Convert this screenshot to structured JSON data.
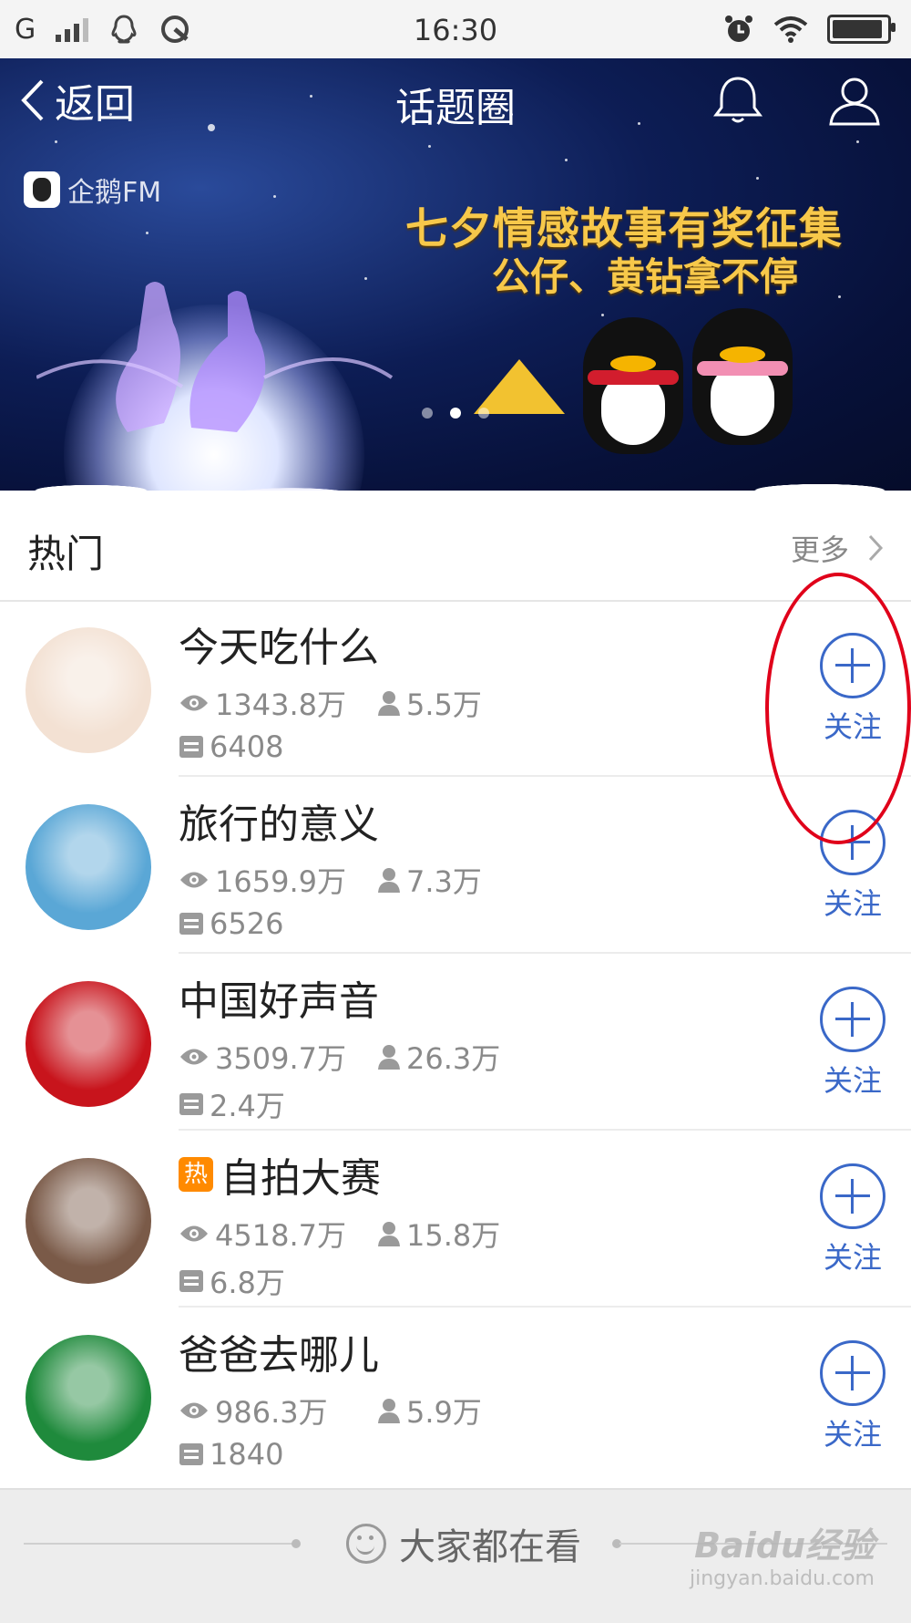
{
  "status_bar": {
    "carrier": "G",
    "time": "16:30"
  },
  "nav": {
    "back_label": "返回",
    "title": "话题圈"
  },
  "banner": {
    "brand": "企鹅FM",
    "headline": "七夕情感故事有奖征集",
    "subline": "公仔、黄钻拿不停",
    "slide_count": 3,
    "active_slide": 2
  },
  "hot": {
    "title": "热门",
    "more_label": "更多"
  },
  "topics": [
    {
      "title": "今天吃什么",
      "hot": false,
      "views": "1343.8万",
      "fans": "5.5万",
      "posts": "6408",
      "follow_label": "关注",
      "avatar_color": "#f3e1d3"
    },
    {
      "title": "旅行的意义",
      "hot": false,
      "views": "1659.9万",
      "fans": "7.3万",
      "posts": "6526",
      "follow_label": "关注",
      "avatar_color": "#5aa7d6"
    },
    {
      "title": "中国好声音",
      "hot": false,
      "views": "3509.7万",
      "fans": "26.3万",
      "posts": "2.4万",
      "follow_label": "关注",
      "avatar_color": "#c8141c"
    },
    {
      "title": "自拍大赛",
      "hot": true,
      "hot_badge": "热",
      "views": "4518.7万",
      "fans": "15.8万",
      "posts": "6.8万",
      "follow_label": "关注",
      "avatar_color": "#7a5a48"
    },
    {
      "title": "爸爸去哪儿",
      "hot": false,
      "views": "986.3万",
      "fans": "5.9万",
      "posts": "1840",
      "follow_label": "关注",
      "avatar_color": "#1f8a3c"
    }
  ],
  "bottom": {
    "label": "大家都在看",
    "watermark": "Baidu经验",
    "watermark_url": "jingyan.baidu.com"
  },
  "colors": {
    "accent": "#3a68c8",
    "hot_badge": "#ff8a00",
    "annotation": "#e0001a"
  }
}
